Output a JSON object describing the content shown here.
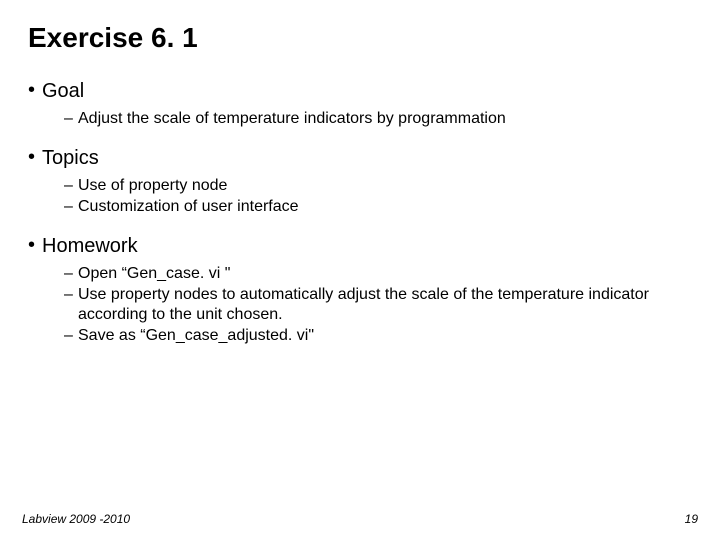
{
  "title": "Exercise 6. 1",
  "sections": [
    {
      "head": "Goal",
      "items": [
        "Adjust the scale of temperature indicators by programmation"
      ]
    },
    {
      "head": "Topics",
      "items": [
        "Use of property node",
        "Customization of user interface"
      ]
    },
    {
      "head": "Homework",
      "items": [
        "Open “Gen_case. vi \"",
        "Use property nodes to automatically adjust the scale of the temperature indicator according to the unit chosen.",
        "Save as “Gen_case_adjusted. vi\""
      ]
    }
  ],
  "footer": {
    "left": "Labview 2009 -2010",
    "right": "19"
  }
}
